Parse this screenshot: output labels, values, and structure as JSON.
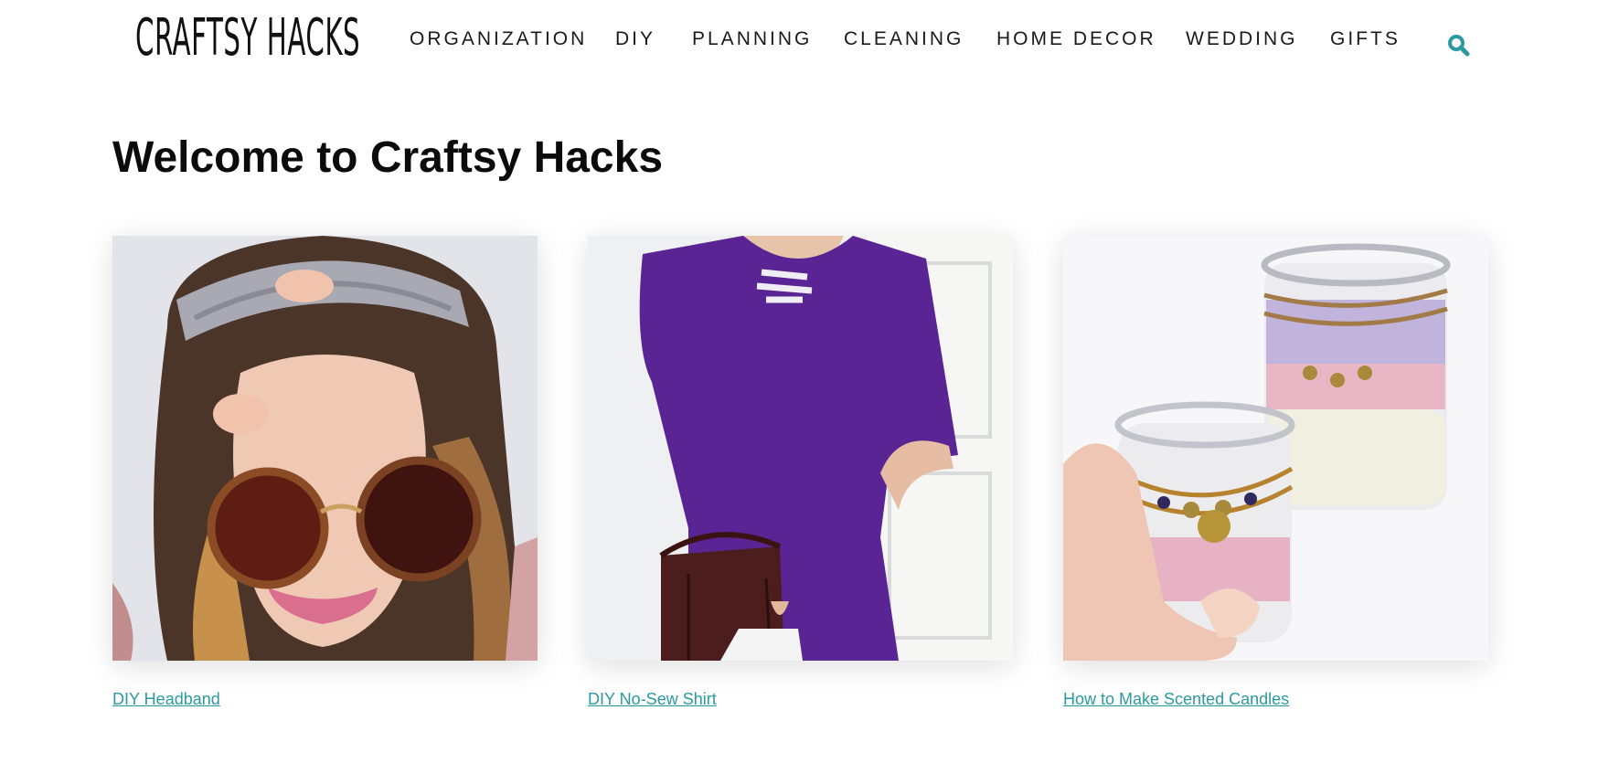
{
  "site": {
    "logo_text": "CRAFTSY HACKS"
  },
  "nav": {
    "items": [
      {
        "label": "ORGANIZATION"
      },
      {
        "label": "DIY"
      },
      {
        "label": "PLANNING"
      },
      {
        "label": "CLEANING"
      },
      {
        "label": "HOME DECOR"
      },
      {
        "label": "WEDDING"
      },
      {
        "label": "GIFTS"
      }
    ],
    "search_icon": "search-icon"
  },
  "main": {
    "title": "Welcome to Craftsy Hacks",
    "cards": [
      {
        "link_text": "DIY Headband"
      },
      {
        "link_text": "DIY No-Sew Shirt"
      },
      {
        "link_text": "How to Make Scented Candles"
      }
    ]
  },
  "colors": {
    "accent": "#2b9aa0",
    "heading": "#0b0b0b",
    "nav_text": "#1a1a1a"
  }
}
